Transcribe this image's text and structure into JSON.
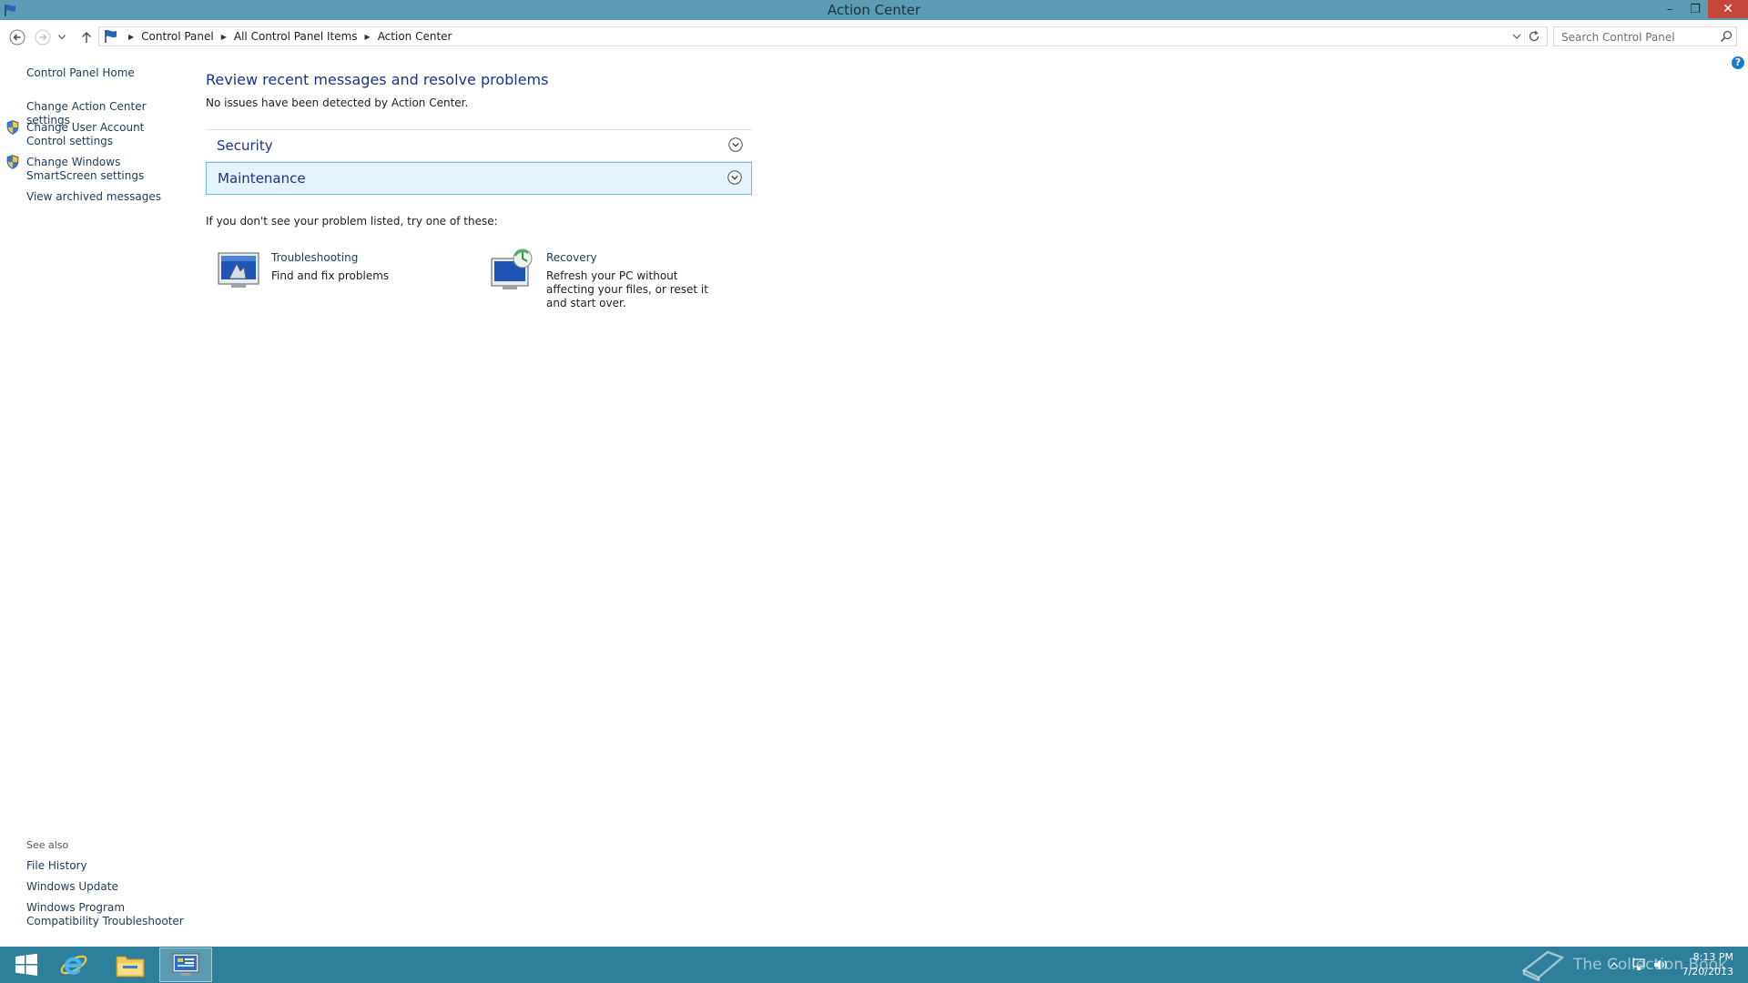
{
  "window": {
    "title": "Action Center"
  },
  "window_controls": {
    "minimize": "–",
    "maximize": "❐",
    "close": "✕"
  },
  "breadcrumb": [
    "Control Panel",
    "All Control Panel Items",
    "Action Center"
  ],
  "search": {
    "placeholder": "Search Control Panel",
    "value": ""
  },
  "help": {
    "label": "?"
  },
  "left_pane": {
    "home": "Control Panel Home",
    "links": [
      "Change Action Center settings",
      "Change User Account Control settings",
      "Change Windows SmartScreen settings",
      "View archived messages"
    ],
    "see_also_title": "See also",
    "see_also": [
      "File History",
      "Windows Update",
      "Windows Program Compatibility Troubleshooter"
    ]
  },
  "main": {
    "heading": "Review recent messages and resolve problems",
    "subtitle": "No issues have been detected by Action Center.",
    "sections": [
      "Security",
      "Maintenance"
    ],
    "hint": "If you don't see your problem listed, try one of these:",
    "tasks": [
      {
        "name": "Troubleshooting",
        "desc": "Find and fix problems"
      },
      {
        "name": "Recovery",
        "desc": "Refresh your PC without affecting your files, or reset it and start over."
      }
    ]
  },
  "taskbar": {
    "watermark": "The Collection Book",
    "time": "8:13 PM",
    "date": "7/20/2013"
  },
  "colors": {
    "titlebar": "#5b9bb4",
    "taskbar": "#2d7f9b",
    "link": "#1e395b",
    "heading": "#1e3287",
    "selected_section_bg": "#e5f3fb",
    "selected_section_border": "#70c0e7",
    "close_button": "#c7463b"
  },
  "icons": {
    "app": "action-center-flag-icon",
    "back": "back-arrow-icon",
    "forward": "forward-arrow-icon",
    "recent": "chevron-down-icon",
    "up": "up-arrow-icon",
    "refresh": "refresh-icon",
    "search": "search-icon",
    "shield": "uac-shield-icon",
    "expand": "expand-chevron-icon",
    "troubleshooting": "troubleshooting-icon",
    "recovery": "recovery-icon",
    "start": "windows-start-icon",
    "ie": "internet-explorer-icon",
    "explorer": "file-explorer-icon",
    "control_panel": "control-panel-icon"
  }
}
